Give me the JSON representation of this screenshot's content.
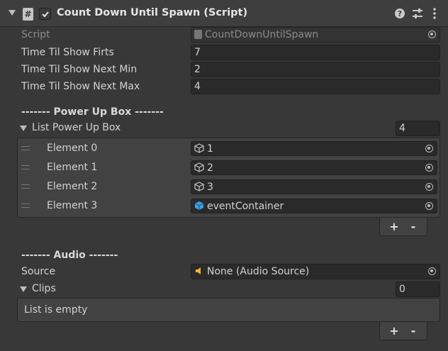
{
  "component": {
    "title": "Count Down Until Spawn (Script)",
    "script_label": "Script",
    "script_value": "CountDownUntilSpawn",
    "script_icon": "#"
  },
  "fields": [
    {
      "label": "Time Til Show Firts",
      "value": "7"
    },
    {
      "label": "Time Til Show Next Min",
      "value": "2"
    },
    {
      "label": "Time Til Show Next Max",
      "value": "4"
    }
  ],
  "powerup": {
    "header": "------- Power Up Box -------",
    "list_label": "List Power Up Box",
    "count": "4",
    "elements": [
      {
        "label": "Element 0",
        "value": "1",
        "icon": "prefab-icon"
      },
      {
        "label": "Element 1",
        "value": "2",
        "icon": "prefab-icon"
      },
      {
        "label": "Element 2",
        "value": "3",
        "icon": "prefab-icon"
      },
      {
        "label": "Element 3",
        "value": "eventContainer",
        "icon": "prefab-blue-icon"
      }
    ],
    "add": "+",
    "remove": "-"
  },
  "audio": {
    "header": "------- Audio -------",
    "source_label": "Source",
    "source_value": "None (Audio Source)",
    "clips_label": "Clips",
    "clips_count": "0",
    "empty_text": "List is empty",
    "add": "+",
    "remove": "-"
  },
  "colors": {
    "prefab_blue": "#3aa0e8",
    "audio_icon": "#f0b429"
  }
}
